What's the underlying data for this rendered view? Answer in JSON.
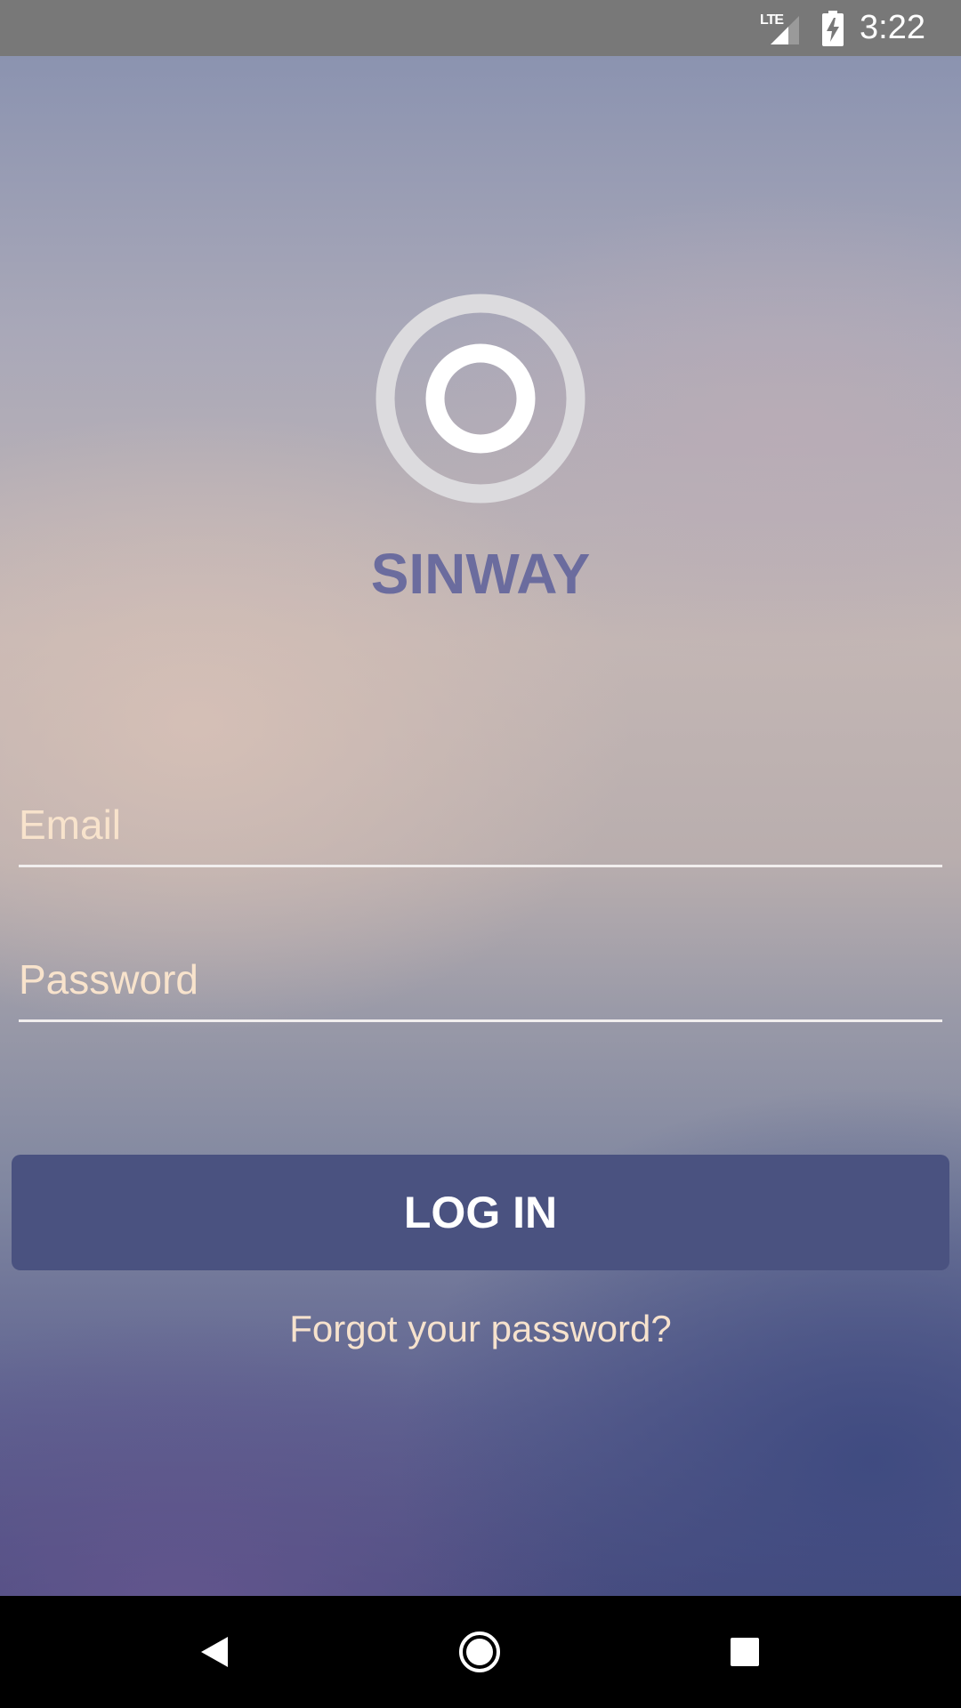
{
  "status_bar": {
    "network": "LTE",
    "time": "3:22",
    "icons": [
      "lte-signal-icon",
      "battery-charging-icon"
    ]
  },
  "app": {
    "logo_icon": "concentric-ring-logo",
    "brand": "SINWAY",
    "brand_color": "#6b6c9e"
  },
  "form": {
    "email": {
      "value": "",
      "placeholder": "Email"
    },
    "password": {
      "value": "",
      "placeholder": "Password"
    },
    "login_label": "LOG IN",
    "forgot_label": "Forgot your password?",
    "button_color": "#4a5280",
    "hint_color": "#f8e3cc"
  },
  "nav_bar": {
    "icons": [
      "back-icon",
      "home-icon",
      "recents-icon"
    ]
  }
}
